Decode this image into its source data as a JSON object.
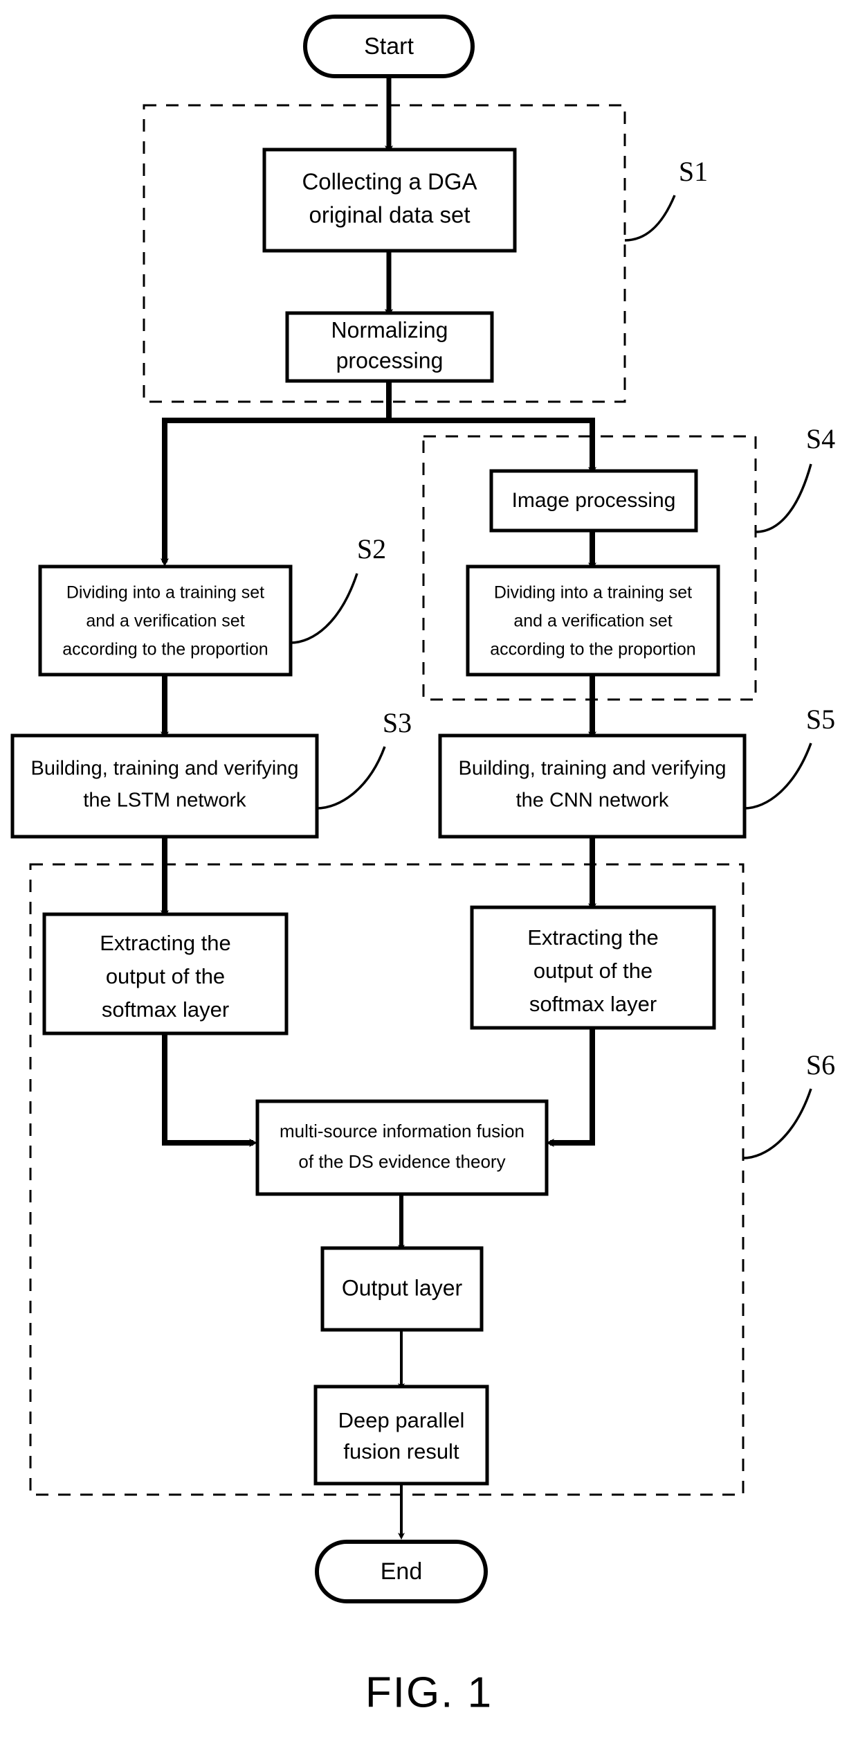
{
  "figure": {
    "caption": "FIG. 1",
    "type": "flowchart"
  },
  "nodes": {
    "start": {
      "label": "Start",
      "shape": "terminator"
    },
    "collecting": {
      "line1": "Collecting a DGA",
      "line2": "original data set",
      "shape": "process"
    },
    "normalizing": {
      "line1": "Normalizing",
      "line2": "processing",
      "shape": "process"
    },
    "image_processing": {
      "line1": "Image processing",
      "shape": "process"
    },
    "dividing_left": {
      "line1": "Dividing into a training set",
      "line2": "and a verification set",
      "line3": "according to the proportion",
      "shape": "process"
    },
    "dividing_right": {
      "line1": "Dividing into a training set",
      "line2": "and a verification set",
      "line3": "according to the proportion",
      "shape": "process"
    },
    "lstm": {
      "line1": "Building, training and verifying",
      "line2": "the LSTM network",
      "shape": "process"
    },
    "cnn": {
      "line1": "Building, training and verifying",
      "line2": "the CNN network",
      "shape": "process"
    },
    "softmax_left": {
      "line1": "Extracting the",
      "line2": "output of the",
      "line3": "softmax layer",
      "shape": "process"
    },
    "softmax_right": {
      "line1": "Extracting the",
      "line2": "output of the",
      "line3": "softmax layer",
      "shape": "process"
    },
    "fusion": {
      "line1": "multi-source information fusion",
      "line2": "of the DS evidence theory",
      "shape": "process"
    },
    "output_layer": {
      "line1": "Output layer",
      "shape": "process"
    },
    "deep_result": {
      "line1": "Deep parallel",
      "line2": "fusion result",
      "shape": "process"
    },
    "end": {
      "label": "End",
      "shape": "terminator"
    }
  },
  "step_labels": {
    "s1": "S1",
    "s2": "S2",
    "s3": "S3",
    "s4": "S4",
    "s5": "S5",
    "s6": "S6"
  },
  "colors": {
    "line": "#000000",
    "fill": "#ffffff",
    "background": "#ffffff"
  }
}
